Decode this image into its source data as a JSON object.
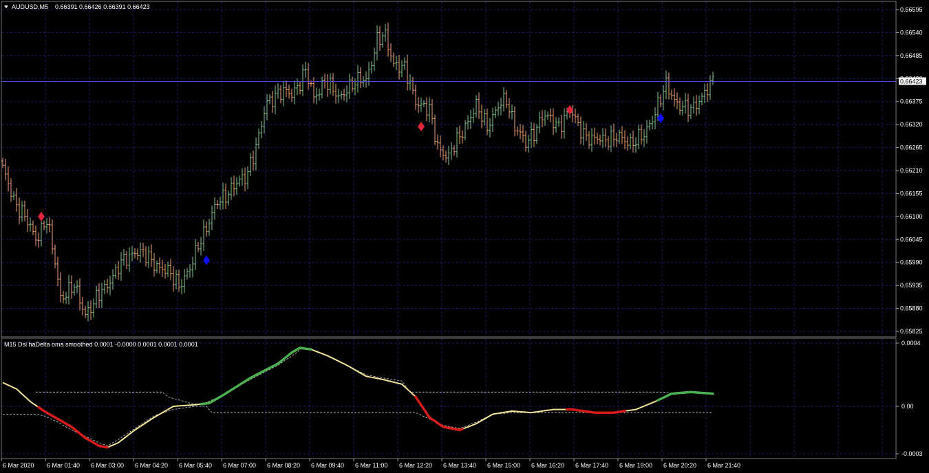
{
  "main_header": {
    "symbol": "AUDUSD,M5",
    "ohlc": "0.66391 0.66426 0.66391 0.66423"
  },
  "price_axis": {
    "ticks": [
      "0.66595",
      "0.66540",
      "0.66485",
      "0.66430",
      "0.66375",
      "0.66320",
      "0.66265",
      "0.66210",
      "0.66155",
      "0.66100",
      "0.66045",
      "0.65990",
      "0.65935",
      "0.65880",
      "0.65825"
    ],
    "current_price_label": "0.66423"
  },
  "indicator": {
    "header": "M15 Dsl haDelta oma smoothed 0.0001 -0.0000 0.0001 0.0001 0.0001",
    "axis_ticks": [
      "0.0004",
      "0.00",
      "-0.0003"
    ]
  },
  "time_axis": {
    "labels": [
      "6 Mar 2020",
      "6 Mar 01:40",
      "6 Mar 03:00",
      "6 Mar 04:20",
      "6 Mar 05:40",
      "6 Mar 07:00",
      "6 Mar 08:20",
      "6 Mar 09:40",
      "6 Mar 11:00",
      "6 Mar 12:20",
      "6 Mar 13:40",
      "6 Mar 15:00",
      "6 Mar 16:20",
      "6 Mar 17:40",
      "6 Mar 19:00",
      "6 Mar 20:20",
      "6 Mar 21:40"
    ]
  },
  "colors": {
    "background": "#000000",
    "grid": "#1c1c6e",
    "bull_bar": "#86c98c",
    "bear_bar": "#f0a37a",
    "sell_signal": "#e0243c",
    "buy_signal": "#1010f0",
    "osc_up": "#4caf50",
    "osc_down": "#d81b1b",
    "osc_neutral": "#f3e59a",
    "levels": "#d0d0d0"
  },
  "chart_data": [
    {
      "type": "ohlc",
      "symbol": "AUDUSD",
      "timeframe": "M5",
      "ylim": [
        0.65825,
        0.66595
      ],
      "anchors": [
        [
          0,
          0.6621
        ],
        [
          5,
          0.6613
        ],
        [
          12,
          0.6605
        ],
        [
          16,
          0.6609
        ],
        [
          19,
          0.6599
        ],
        [
          21,
          0.6591
        ],
        [
          26,
          0.6593
        ],
        [
          30,
          0.6587
        ],
        [
          33,
          0.6589
        ],
        [
          40,
          0.6596
        ],
        [
          45,
          0.66
        ],
        [
          48,
          0.6602
        ],
        [
          55,
          0.6599
        ],
        [
          59,
          0.6597
        ],
        [
          64,
          0.6594
        ],
        [
          68,
          0.6597
        ],
        [
          72,
          0.6605
        ],
        [
          78,
          0.6613
        ],
        [
          83,
          0.6617
        ],
        [
          88,
          0.6619
        ],
        [
          93,
          0.6629
        ],
        [
          96,
          0.6637
        ],
        [
          100,
          0.664
        ],
        [
          105,
          0.6639
        ],
        [
          110,
          0.6645
        ],
        [
          113,
          0.6638
        ],
        [
          117,
          0.6643
        ],
        [
          122,
          0.6638
        ],
        [
          125,
          0.6641
        ],
        [
          132,
          0.6643
        ],
        [
          136,
          0.6652
        ],
        [
          139,
          0.6653
        ],
        [
          142,
          0.6647
        ],
        [
          146,
          0.6645
        ],
        [
          150,
          0.6638
        ],
        [
          155,
          0.6635
        ],
        [
          158,
          0.6627
        ],
        [
          162,
          0.6624
        ],
        [
          168,
          0.6632
        ],
        [
          172,
          0.6636
        ],
        [
          176,
          0.6632
        ],
        [
          180,
          0.6636
        ],
        [
          183,
          0.6638
        ],
        [
          186,
          0.6632
        ],
        [
          190,
          0.6627
        ],
        [
          196,
          0.6634
        ],
        [
          202,
          0.6632
        ],
        [
          206,
          0.6635
        ],
        [
          210,
          0.6631
        ],
        [
          214,
          0.6628
        ],
        [
          220,
          0.6629
        ],
        [
          228,
          0.6628
        ],
        [
          233,
          0.6629
        ],
        [
          238,
          0.6637
        ],
        [
          241,
          0.6641
        ],
        [
          244,
          0.6638
        ],
        [
          250,
          0.6635
        ],
        [
          255,
          0.664
        ],
        [
          258,
          0.6642
        ]
      ],
      "signals": [
        {
          "index": 14,
          "kind": "sell",
          "price": 0.661
        },
        {
          "index": 74,
          "kind": "buy",
          "price": 0.65995
        },
        {
          "index": 152,
          "kind": "sell",
          "price": 0.66315
        },
        {
          "index": 206,
          "kind": "sell",
          "price": 0.66355
        },
        {
          "index": 239,
          "kind": "buy",
          "price": 0.66335
        }
      ],
      "current_price": 0.66423
    },
    {
      "type": "line",
      "name": "M15 Dsl haDelta oma smoothed",
      "ylim": [
        -0.0003,
        0.0004
      ],
      "anchors": [
        [
          0,
          0.00015
        ],
        [
          5,
          0.00011
        ],
        [
          10,
          3e-05
        ],
        [
          15,
          -3e-05
        ],
        [
          20,
          -8e-05
        ],
        [
          25,
          -0.00013
        ],
        [
          30,
          -0.0002
        ],
        [
          35,
          -0.00025
        ],
        [
          38,
          -0.00026
        ],
        [
          42,
          -0.00023
        ],
        [
          48,
          -0.00015
        ],
        [
          55,
          -7e-05
        ],
        [
          62,
          0.0
        ],
        [
          70,
          1e-05
        ],
        [
          75,
          2e-05
        ],
        [
          80,
          7e-05
        ],
        [
          90,
          0.00018
        ],
        [
          100,
          0.00027
        ],
        [
          105,
          0.00034
        ],
        [
          108,
          0.00037
        ],
        [
          112,
          0.00036
        ],
        [
          118,
          0.00032
        ],
        [
          125,
          0.00026
        ],
        [
          132,
          0.00019
        ],
        [
          138,
          0.00017
        ],
        [
          145,
          0.00014
        ],
        [
          150,
          6e-05
        ],
        [
          155,
          -7e-05
        ],
        [
          160,
          -0.00013
        ],
        [
          166,
          -0.00015
        ],
        [
          172,
          -0.00011
        ],
        [
          178,
          -5e-05
        ],
        [
          185,
          -3e-05
        ],
        [
          192,
          -4e-05
        ],
        [
          200,
          -2e-05
        ],
        [
          207,
          -2e-05
        ],
        [
          215,
          -4e-05
        ],
        [
          222,
          -4e-05
        ],
        [
          230,
          -2e-05
        ],
        [
          237,
          3e-05
        ],
        [
          243,
          8e-05
        ],
        [
          250,
          9e-05
        ],
        [
          258,
          8e-05
        ]
      ],
      "up_ranges": [
        [
          72,
          112
        ],
        [
          238,
          258
        ]
      ],
      "down_ranges": [
        [
          13,
          38
        ],
        [
          150,
          167
        ],
        [
          205,
          226
        ]
      ],
      "upper_level": [
        [
          12,
          9e-05
        ],
        [
          58,
          9e-05
        ],
        [
          60,
          6e-05
        ],
        [
          68,
          2e-05
        ],
        [
          72,
          1e-05
        ],
        [
          80,
          7e-05
        ],
        [
          90,
          0.00017
        ],
        [
          100,
          0.00026
        ],
        [
          106,
          0.00033
        ],
        [
          109,
          0.00037
        ],
        [
          114,
          0.00035
        ],
        [
          120,
          0.0003
        ],
        [
          126,
          0.00025
        ],
        [
          132,
          0.0002
        ],
        [
          138,
          0.00018
        ],
        [
          145,
          0.00016
        ],
        [
          148,
          9e-05
        ],
        [
          240,
          9e-05
        ],
        [
          243,
          8e-05
        ]
      ],
      "lower_level": [
        [
          0,
          -5e-05
        ],
        [
          12,
          -5e-05
        ],
        [
          15,
          -6e-05
        ],
        [
          20,
          -0.0001
        ],
        [
          25,
          -0.00015
        ],
        [
          30,
          -0.00019
        ],
        [
          35,
          -0.00023
        ],
        [
          38,
          -0.00025
        ],
        [
          42,
          -0.00021
        ],
        [
          48,
          -0.00014
        ],
        [
          55,
          -6e-05
        ],
        [
          62,
          -2e-05
        ],
        [
          70,
          0.0
        ],
        [
          74,
          0.0
        ],
        [
          76,
          -4e-05
        ],
        [
          150,
          -4e-05
        ],
        [
          155,
          -8e-05
        ],
        [
          160,
          -0.00012
        ],
        [
          166,
          -0.00014
        ],
        [
          172,
          -0.0001
        ],
        [
          178,
          -5e-05
        ],
        [
          185,
          -4e-05
        ],
        [
          230,
          -4e-05
        ],
        [
          258,
          -4e-05
        ]
      ]
    }
  ]
}
